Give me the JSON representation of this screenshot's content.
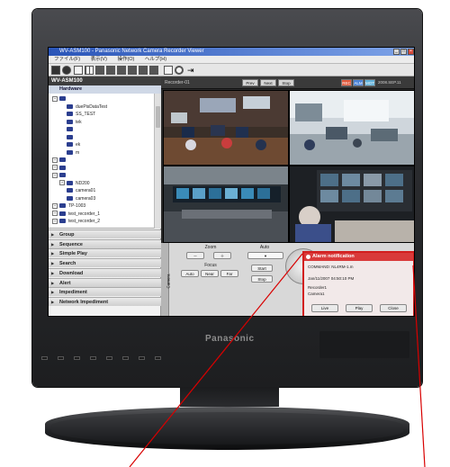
{
  "window": {
    "title": "WV-ASM100 - Panasonic Network Camera Recorder Viewer"
  },
  "menu": [
    "ファイル(F)",
    "表示(V)",
    "操作(O)",
    "ヘルプ(H)"
  ],
  "left_panel": {
    "title": "WV-ASM100",
    "section": "Hardware",
    "tree": [
      {
        "label": "",
        "indent": 0
      },
      {
        "label": "duePisDataTest",
        "indent": 2
      },
      {
        "label": "SS_TEST",
        "indent": 2
      },
      {
        "label": "tek",
        "indent": 2
      },
      {
        "label": "",
        "indent": 2
      },
      {
        "label": "",
        "indent": 2
      },
      {
        "label": "ek",
        "indent": 2
      },
      {
        "label": "m",
        "indent": 2
      },
      {
        "label": "",
        "indent": 0
      },
      {
        "label": "",
        "indent": 0
      },
      {
        "label": "",
        "indent": 0
      },
      {
        "label": "ND200",
        "indent": 1
      },
      {
        "label": "camera01",
        "indent": 2
      },
      {
        "label": "camera03",
        "indent": 2
      },
      {
        "label": "TP-1003",
        "indent": 0
      },
      {
        "label": "test_recorder_1",
        "indent": 0
      },
      {
        "label": "test_recorder_2",
        "indent": 0
      }
    ],
    "nav": [
      "Group",
      "Sequence",
      "Simple Play",
      "Search",
      "Download",
      "Alert",
      "Impediment",
      "Network Impediment"
    ]
  },
  "camera_view": {
    "header_label": "Recorder-01",
    "header_buttons": [
      "Prev",
      "Next",
      "Stop"
    ],
    "status_badges": [
      "REC",
      "ALM",
      "MOT"
    ],
    "datetime": "2008.SEP.11 14:15:09"
  },
  "control_panel": {
    "tab_label": "Camera",
    "zoom_label": "Zoom",
    "focus_label": "Focus",
    "focus_buttons": [
      "Auto",
      "Near",
      "Far"
    ],
    "auto_label": "Auto",
    "start_button": "Start",
    "stop_button": "Stop"
  },
  "alarm": {
    "title": "Alarm notification",
    "command": "COMMAND: NL4RM-1.m",
    "timestamp": "Jan/11/2007 04:50:10 PM",
    "recorder": "Recorder1",
    "camera": "Camera1",
    "buttons": [
      "Live",
      "Play",
      "Close"
    ]
  },
  "monitor": {
    "brand": "Panasonic"
  },
  "colors": {
    "alarm_accent": "#d21e1e",
    "bezel": "#2b2c2f",
    "title_blue": "#2a55b8"
  }
}
